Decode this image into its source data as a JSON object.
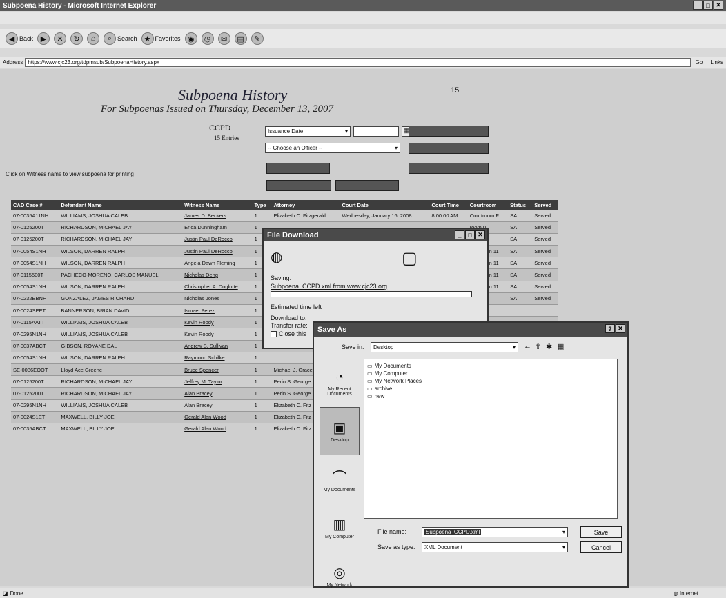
{
  "window": {
    "title": "Subpoena History - Microsoft Internet Explorer"
  },
  "menu": [],
  "toolbar": {
    "back": "Back",
    "search": "Search",
    "favorites": "Favorites"
  },
  "address": {
    "label": "Address",
    "url": "https://www.cjc23.org/tdpmsub/SubpoenaHistory.aspx",
    "go": "Go",
    "links": "Links"
  },
  "page": {
    "title": "Subpoena History",
    "subtitle": "For Subpoenas Issued on Thursday, December 13, 2007",
    "count": "15",
    "agency": "CCPD",
    "entries_label": "15 Entries",
    "date_select": "Issuance Date",
    "officer_select": "-- Choose an Officer --",
    "hint": "Click on Witness name to view subpoena for printing"
  },
  "table": {
    "headers": [
      "CAD Case #",
      "Defendant Name",
      "Witness Name",
      "Type",
      "Attorney",
      "Court Date",
      "Court Time",
      "Courtroom",
      "Status",
      "Served"
    ],
    "rows": [
      [
        "07-0035A11NH",
        "WILLIAMS, JOSHUA CALEB",
        "James D. Beckers",
        "1",
        "Elizabeth C. Fitzgerald",
        "Wednesday, January 16, 2008",
        "8:00:00 AM",
        "Courtroom F",
        "SA",
        "Served"
      ],
      [
        "07-0125200T",
        "RICHARDSON, MICHAEL JAY",
        "Erica Dunningham",
        "1",
        "",
        "",
        "",
        "room 0",
        "SA",
        "Served"
      ],
      [
        "07-0125200T",
        "RICHARDSON, MICHAEL JAY",
        "Justin Paul DeRocco",
        "1",
        "",
        "",
        "",
        "room 0",
        "SA",
        "Served"
      ],
      [
        "07-0054S1NH",
        "WILSON, DARREN RALPH",
        "Justin Paul DeRocco",
        "1",
        "",
        "",
        "",
        "ing Room 11",
        "SA",
        "Served"
      ],
      [
        "07-0054S1NH",
        "WILSON, DARREN RALPH",
        "Angela Dawn Fleming",
        "1",
        "",
        "",
        "",
        "ing Room 11",
        "SA",
        "Served"
      ],
      [
        "07-0115500T",
        "PACHECO-MORENO, CARLOS MANUEL",
        "Nicholas Deng",
        "1",
        "",
        "",
        "",
        "ing Room 11",
        "SA",
        "Served"
      ],
      [
        "07-0054S1NH",
        "WILSON, DARREN RALPH",
        "Christopher A. Doglotte",
        "1",
        "",
        "",
        "",
        "ing Room 11",
        "SA",
        "Served"
      ],
      [
        "07-0232EBNH",
        "GONZALEZ, JAMES RICHARD",
        "Nicholas Jones",
        "1",
        "",
        "",
        "",
        "",
        "SA",
        "Served"
      ],
      [
        "07-0024SEET",
        "BANNERSON, BRIAN DAVID",
        "Ismael Perez",
        "1",
        "",
        "",
        "",
        "",
        "",
        ""
      ],
      [
        "07-0115AATT",
        "WILLIAMS, JOSHUA CALEB",
        "Kevin Roody",
        "1",
        "",
        "",
        "",
        "",
        "",
        ""
      ],
      [
        "07-0295N1NH",
        "WILLIAMS, JOSHUA CALEB",
        "Kevin Roody",
        "1",
        "",
        "",
        "",
        "",
        "",
        ""
      ],
      [
        "07-0037ABCT",
        "GIBSON, ROYANE DAL",
        "Andrew S. Sullivan",
        "1",
        "",
        "",
        "",
        "",
        "",
        ""
      ],
      [
        "07-0054S1NH",
        "WILSON, DARREN RALPH",
        "Raymond Schilke",
        "1",
        "",
        "",
        "",
        "",
        "",
        ""
      ],
      [
        "SE-0036EOOT",
        "Lloyd Ace Greene",
        "Bruce Spencer",
        "1",
        "Michael J. Gracey",
        "",
        "",
        "",
        "",
        ""
      ],
      [
        "07-0125200T",
        "RICHARDSON, MICHAEL JAY",
        "Jeffrey M. Taylor",
        "1",
        "Perin S. George",
        "",
        "",
        "",
        "",
        ""
      ],
      [
        "07-0125200T",
        "RICHARDSON, MICHAEL JAY",
        "Alan Bracey",
        "1",
        "Perin S. George",
        "",
        "",
        "",
        "",
        ""
      ],
      [
        "07-0295N1NH",
        "WILLIAMS, JOSHUA CALEB",
        "Alan Bracey",
        "1",
        "Elizabeth C. Fitz",
        "",
        "",
        "",
        "",
        ""
      ],
      [
        "07-0024S1ET",
        "MAXWELL, BILLY JOE",
        "Gerald Alan Wood",
        "1",
        "Elizabeth C. Fitz",
        "",
        "",
        "",
        "",
        ""
      ],
      [
        "07-0035ABCT",
        "MAXWELL, BILLY JOE",
        "Gerald Alan Wood",
        "1",
        "Elizabeth C. Fitz",
        "",
        "",
        "",
        "",
        ""
      ]
    ]
  },
  "download": {
    "title": "File Download",
    "saving": "Saving:",
    "file": "Subpoena_CCPD.xml from www.cjc23.org",
    "estimated": "Estimated time left",
    "download_to": "Download to:",
    "transfer": "Transfer rate:",
    "close_when": "Close this"
  },
  "save": {
    "title": "Save As",
    "save_in_label": "Save in:",
    "save_in_value": "Desktop",
    "places": [
      "My Recent Documents",
      "Desktop",
      "My Documents",
      "My Computer",
      "My Network"
    ],
    "files": [
      "My Documents",
      "My Computer",
      "My Network Places",
      "archive",
      "new"
    ],
    "filename_label": "File name:",
    "filename": "Subpoena_CCPD.xml",
    "type_label": "Save as type:",
    "type": "XML Document",
    "save_btn": "Save",
    "cancel_btn": "Cancel"
  },
  "status": {
    "left": "Done",
    "right": "Internet"
  }
}
